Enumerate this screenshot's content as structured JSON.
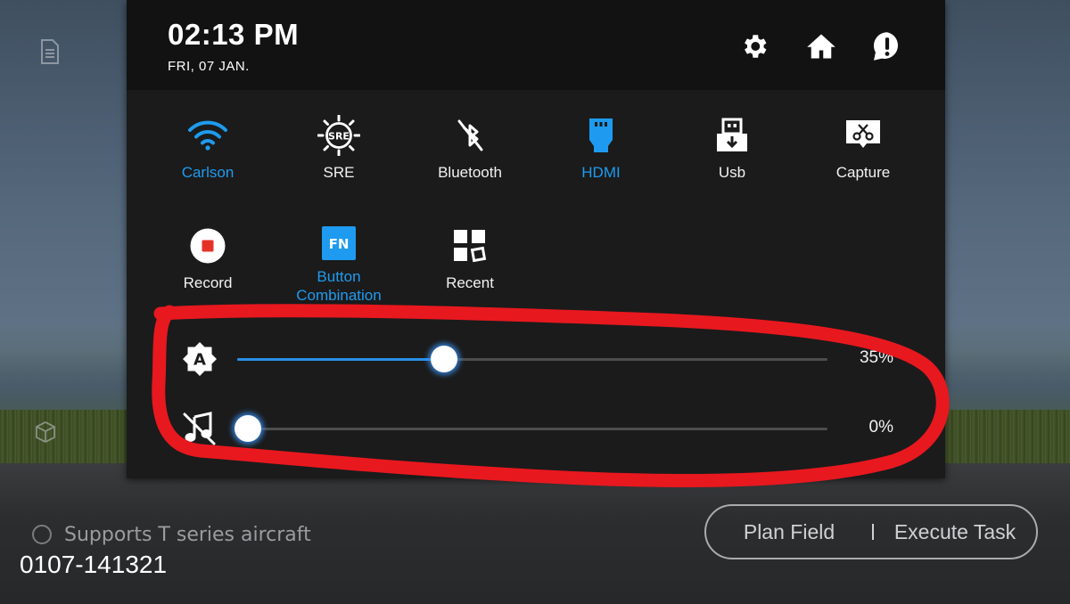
{
  "status": {
    "time": "02:13 PM",
    "date": "FRI, 07 JAN."
  },
  "header_icons": [
    "gear-icon",
    "home-icon",
    "alert-icon"
  ],
  "tiles": [
    {
      "label": "Carlson",
      "icon": "wifi-icon",
      "active": true
    },
    {
      "label": "SRE",
      "icon": "sre-icon",
      "active": false
    },
    {
      "label": "Bluetooth",
      "icon": "bluetooth-off-icon",
      "active": false
    },
    {
      "label": "HDMI",
      "icon": "hdmi-icon",
      "active": true
    },
    {
      "label": "Usb",
      "icon": "usb-icon",
      "active": false
    },
    {
      "label": "Capture",
      "icon": "capture-icon",
      "active": false
    },
    {
      "label": "Record",
      "icon": "record-icon",
      "active": false
    },
    {
      "label": "Button\nCombination",
      "icon": "fn-icon",
      "active": true
    },
    {
      "label": "Recent",
      "icon": "recent-apps-icon",
      "active": false
    }
  ],
  "sliders": {
    "brightness": {
      "value": 35,
      "label": "35%",
      "icon": "auto-brightness-icon"
    },
    "volume": {
      "value": 0,
      "label": "0%",
      "icon": "music-muted-icon"
    }
  },
  "background_app": {
    "support_text": "Supports T series aircraft",
    "plan_field": "Plan Field",
    "execute_task": "Execute Task"
  },
  "watermark": "0107-141321",
  "colors": {
    "accent": "#1e9bf0",
    "panel": "#1b1b1b",
    "header": "#121212",
    "annotation": "#e8181f"
  }
}
